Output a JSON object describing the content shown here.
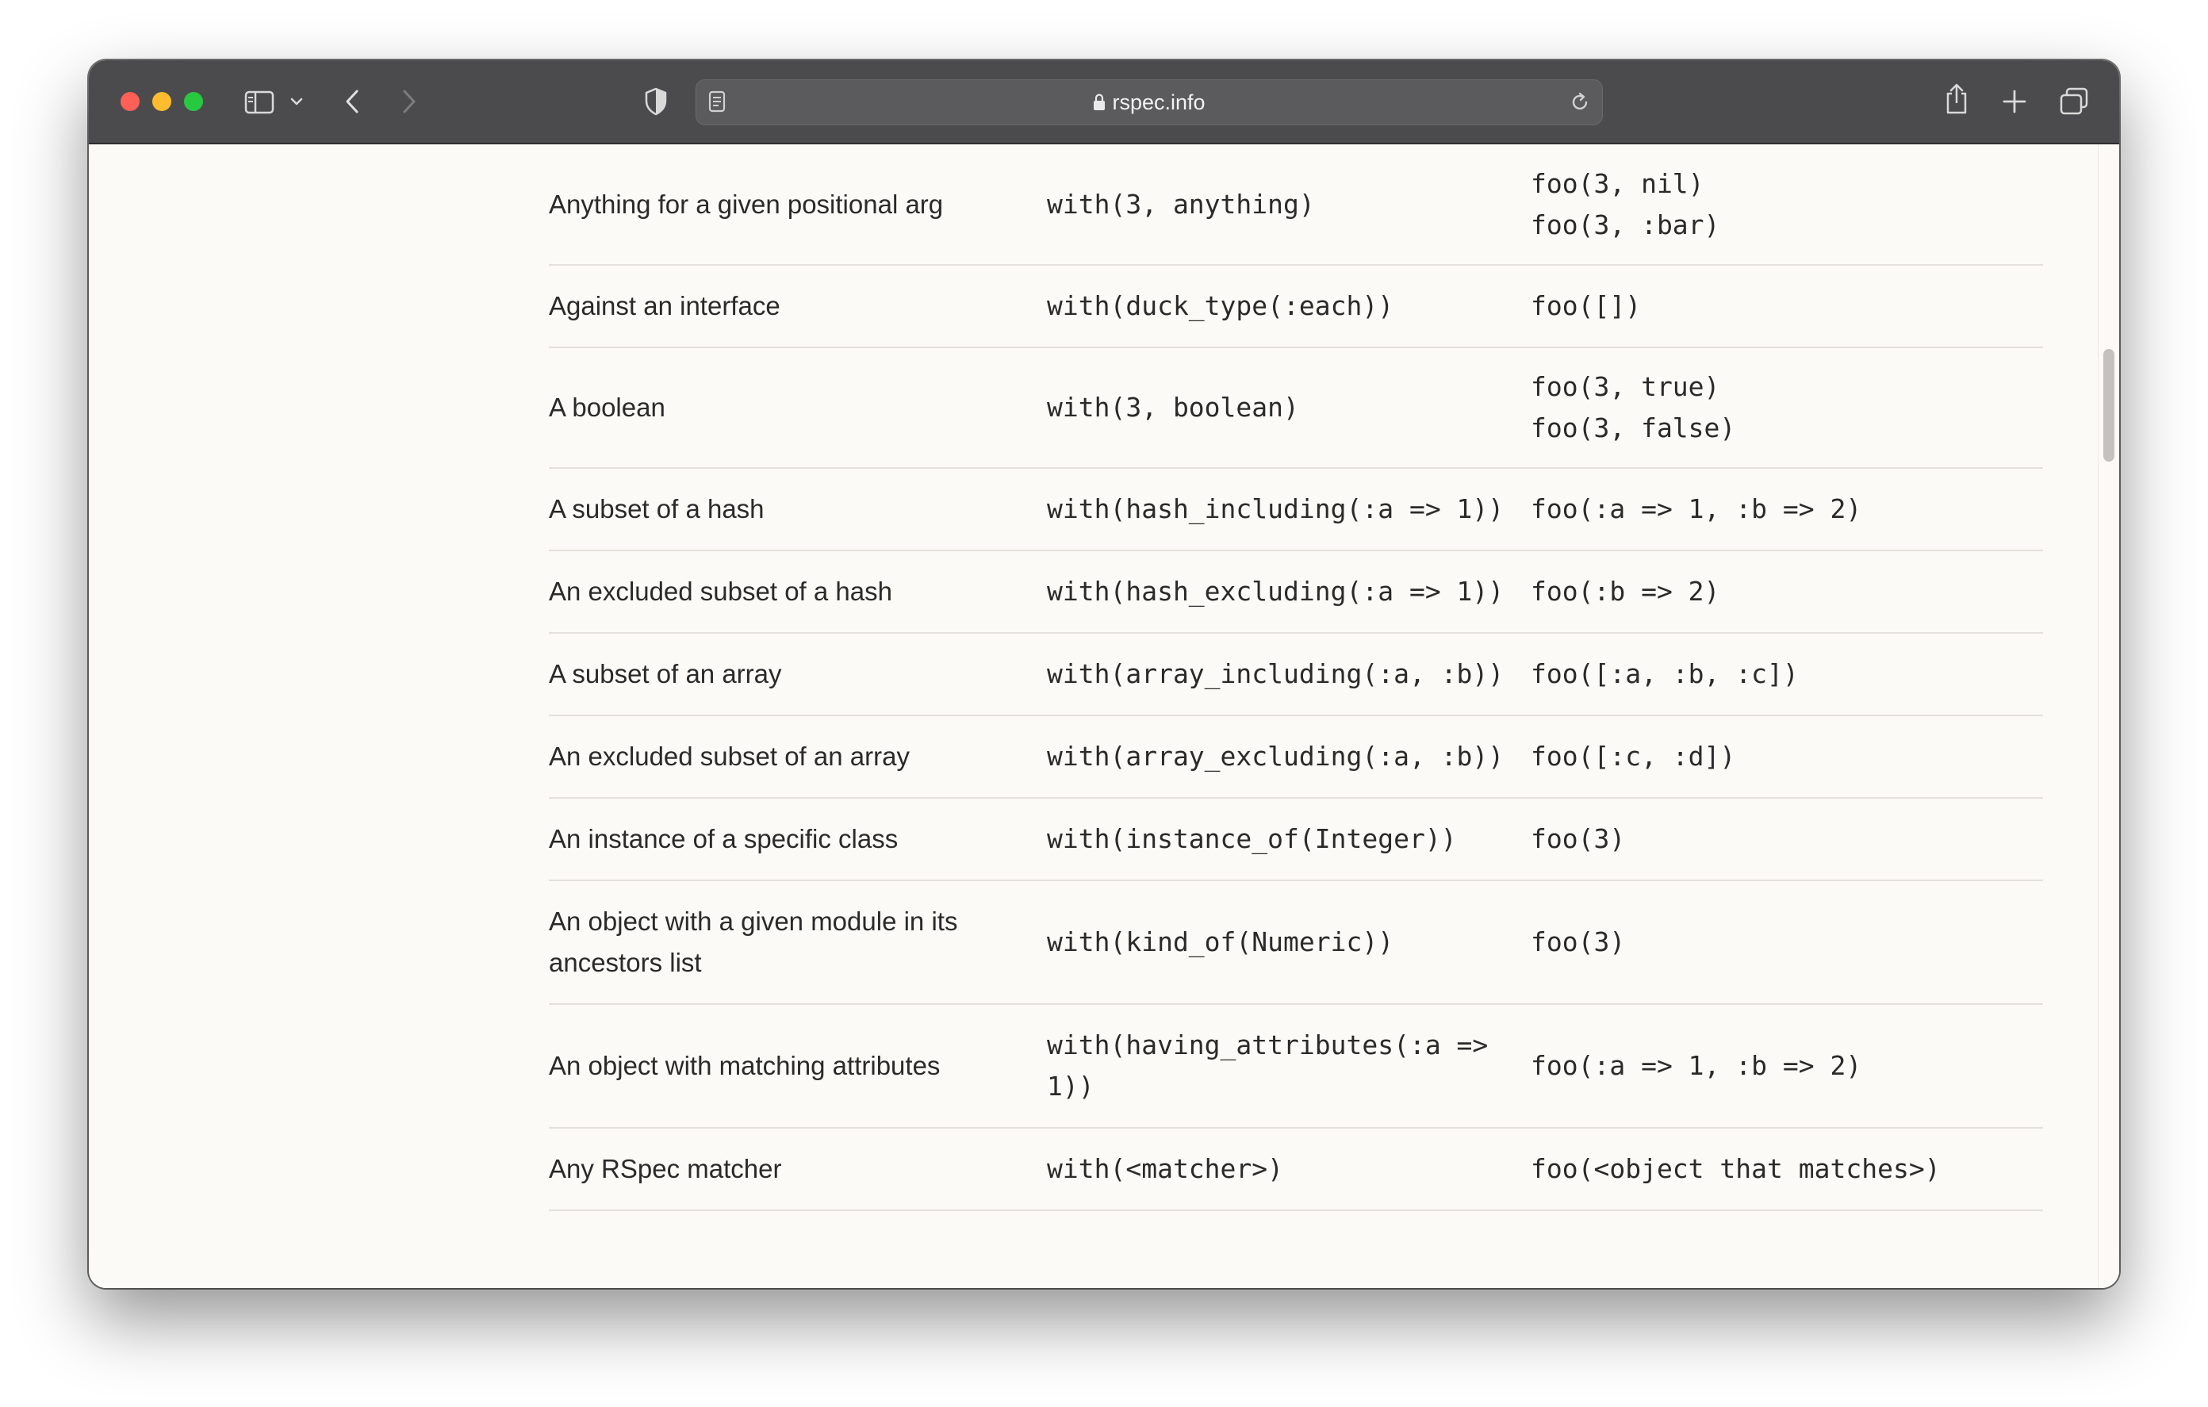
{
  "browser": {
    "url_text": "rspec.info"
  },
  "table": {
    "rows": [
      {
        "description": "Anything for a given positional arg",
        "code": [
          "with(3, anything)"
        ],
        "examples": [
          "foo(3, nil)",
          "foo(3, :bar)"
        ]
      },
      {
        "description": "Against an interface",
        "code": [
          "with(duck_type(:each))"
        ],
        "examples": [
          "foo([])"
        ]
      },
      {
        "description": "A boolean",
        "code": [
          "with(3, boolean)"
        ],
        "examples": [
          "foo(3, true)",
          "foo(3, false)"
        ]
      },
      {
        "description": "A subset of a hash",
        "code": [
          "with(hash_including(:a => 1))"
        ],
        "examples": [
          "foo(:a => 1, :b => 2)"
        ]
      },
      {
        "description": "An excluded subset of a hash",
        "code": [
          "with(hash_excluding(:a => 1))"
        ],
        "examples": [
          "foo(:b => 2)"
        ]
      },
      {
        "description": "A subset of an array",
        "code": [
          "with(array_including(:a, :b))"
        ],
        "examples": [
          "foo([:a, :b, :c])"
        ]
      },
      {
        "description": "An excluded subset of an array",
        "code": [
          "with(array_excluding(:a, :b))"
        ],
        "examples": [
          "foo([:c, :d])"
        ]
      },
      {
        "description": "An instance of a specific class",
        "code": [
          "with(instance_of(Integer))"
        ],
        "examples": [
          "foo(3)"
        ]
      },
      {
        "description": "An object with a given module in its ancestors list",
        "code": [
          "with(kind_of(Numeric))"
        ],
        "examples": [
          "foo(3)"
        ]
      },
      {
        "description": "An object with matching attributes",
        "code": [
          "with(having_attributes(:a =>",
          "1))"
        ],
        "examples": [
          "foo(:a => 1, :b => 2)"
        ]
      },
      {
        "description": "Any RSpec matcher",
        "code": [
          "with(<matcher>)"
        ],
        "examples": [
          "foo(<object that matches>)"
        ]
      }
    ]
  }
}
